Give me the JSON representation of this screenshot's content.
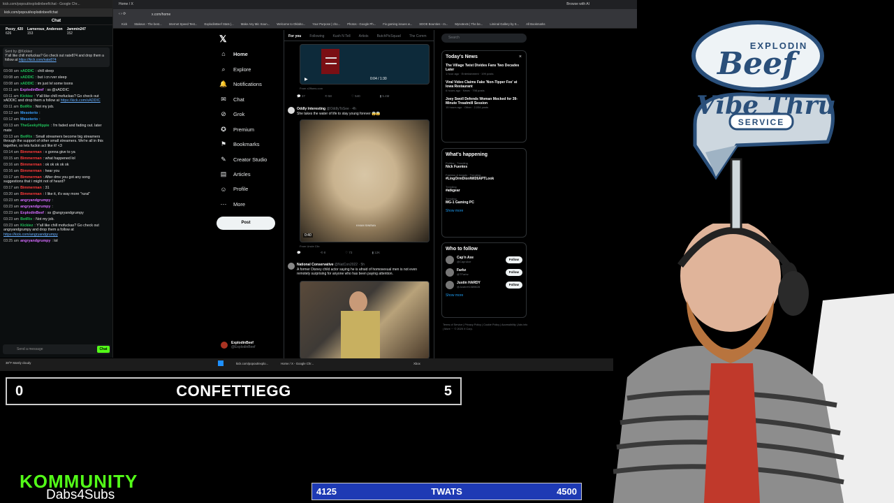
{
  "chat_window": {
    "title_text": "kick.com/popout/explodinbeef/chat - Google Chr...",
    "url": "kick.com/popout/explodinbeef/chat",
    "header": "Chat",
    "gifters": [
      {
        "name": "Pezzy_420",
        "count": "626"
      },
      {
        "name": "Larnerous_Anderson",
        "count": "153"
      },
      {
        "name": "Jammin247",
        "count": "152"
      }
    ],
    "pinned": {
      "sender": "Sent by @Kickiez",
      "text": "Y'all like chill mofuckas? Go check out nate874 and drop them a follow at",
      "link": "https://kick.com/nate874"
    },
    "messages": [
      {
        "time": "03:08 am",
        "user": "xADDIC",
        "color": "#21c05a",
        "text": ": chill sleep"
      },
      {
        "time": "03:08 am",
        "user": "xADDIC",
        "color": "#21c05a",
        "text": ": but i cn rver sleep"
      },
      {
        "time": "03:08 am",
        "user": "xADDIC",
        "color": "#21c05a",
        "text": ": im just lvl some toons"
      },
      {
        "time": "03:11 am",
        "user": "ExplodinBeef",
        "color": "#d46bff",
        "text": ": ss @xADDIC"
      },
      {
        "time": "03:11 am",
        "user": "Kickiez",
        "color": "#21c05a",
        "text": ": Y'all like chill mofuckas? Go check out xADDIC and drop them a follow at ",
        "link": "https://kick.com/xADDIC"
      },
      {
        "time": "03:11 am",
        "user": "BotRix",
        "color": "#21c05a",
        "text": ": Not my job."
      },
      {
        "time": "03:12 am",
        "user": "Mesoterio",
        "color": "#3aa0ff",
        "text": ":"
      },
      {
        "time": "03:12 am",
        "user": "Mesoterio",
        "color": "#3aa0ff",
        "text": ":"
      },
      {
        "time": "03:13 am",
        "user": "TheGeekyHippie",
        "color": "#21c05a",
        "text": ": I'm faded and fading out. later mate"
      },
      {
        "time": "03:13 am",
        "user": "BotRix",
        "color": "#21c05a",
        "text": ": Small streamers become big streamers through the support of other small streamers. We're all in this together, so lets fuckin act like it! <3"
      },
      {
        "time": "03:14 am",
        "user": "Bimmerman",
        "color": "#ff3b3b",
        "text": ": x gonna give to ya"
      },
      {
        "time": "03:15 am",
        "user": "Bimmerman",
        "color": "#ff3b3b",
        "text": ": what happened lol"
      },
      {
        "time": "03:16 am",
        "user": "Bimmerman",
        "color": "#ff3b3b",
        "text": ": ok ok ok ok ok"
      },
      {
        "time": "03:16 am",
        "user": "Bimmerman",
        "color": "#ff3b3b",
        "text": ": hear you"
      },
      {
        "time": "03:17 am",
        "user": "Bimmerman",
        "color": "#ff3b3b",
        "text": ": After dmx you got any song suggestions that i might not of heard?"
      },
      {
        "time": "03:17 am",
        "user": "Bimmerman",
        "color": "#ff3b3b",
        "text": ": 31"
      },
      {
        "time": "03:20 am",
        "user": "Bimmerman",
        "color": "#ff3b3b",
        "text": ": I like it, it's way more \"rural\""
      },
      {
        "time": "03:23 am",
        "user": "angryandgrumpy",
        "color": "#d46bff",
        "text": ":"
      },
      {
        "time": "03:23 am",
        "user": "angryandgrumpy",
        "color": "#d46bff",
        "text": ":"
      },
      {
        "time": "03:23 am",
        "user": "ExplodinBeef",
        "color": "#d46bff",
        "text": ": ss @angryandgrumpy"
      },
      {
        "time": "03:23 am",
        "user": "BotRix",
        "color": "#21c05a",
        "text": ": Not my job."
      },
      {
        "time": "03:23 am",
        "user": "Kickiez",
        "color": "#21c05a",
        "text": ": Y'all like chill mofuckas? Go check out angryandgrumpy and drop them a follow at ",
        "link": "https://kick.com/angryandgrumpy"
      },
      {
        "time": "03:25 am",
        "user": "angryandgrumpy",
        "color": "#d46bff",
        "text": ": lol"
      }
    ],
    "input_placeholder": "Send a message",
    "send_label": "Chat"
  },
  "browser": {
    "tab_title": "Home / X",
    "address": "x.com/home",
    "browse_ai": "Browse with AI",
    "bookmarks": [
      "Kick",
      "Stakeus - The best...",
      "Internet Speed Test...",
      "ExplodinBeef Stats |...",
      "Make Any Mic Soun...",
      "Welcome to Oklaho...",
      "Your Purpose | cho...",
      "Photos - Google Ph...",
      "Fix gaming issues w...",
      "SDOE Bounties - m...",
      "Mynotexts | The be...",
      "Liminal Gallery by S...",
      "All Bookmarks"
    ]
  },
  "x_nav": {
    "items": [
      {
        "label": "Home",
        "icon": "home-icon"
      },
      {
        "label": "Explore",
        "icon": "search-icon"
      },
      {
        "label": "Notifications",
        "icon": "bell-icon"
      },
      {
        "label": "Chat",
        "icon": "chat-icon"
      },
      {
        "label": "Grok",
        "icon": "grok-icon"
      },
      {
        "label": "Premium",
        "icon": "premium-icon"
      },
      {
        "label": "Bookmarks",
        "icon": "bookmark-icon"
      },
      {
        "label": "Creator Studio",
        "icon": "creator-icon"
      },
      {
        "label": "Articles",
        "icon": "articles-icon"
      },
      {
        "label": "Profile",
        "icon": "profile-icon"
      },
      {
        "label": "More",
        "icon": "more-icon"
      }
    ],
    "post_label": "Post",
    "account_name": "ExplodinBeef",
    "account_handle": "@ExplodinBeef"
  },
  "feed": {
    "tabs": [
      "For you",
      "Following",
      "Kush N Tell",
      "Artists",
      "ButchPicSquad",
      "The Comm"
    ],
    "video_time": "0:04 / 1:30",
    "first_source": "From x2ffoms.com",
    "tweets": [
      {
        "name": "Oddly Interesting",
        "handle": "@OddlyToSee · 4h",
        "text": "She takes the water of life to stay young forever 😱😱",
        "duration": "0:40",
        "from": "From Uncle Clix",
        "watermark": "KHAM SINEMA"
      },
      {
        "name": "National Conservative",
        "handle": "@NatCon2022 · 5h",
        "text": "A former Disney child actor saying he is afraid of homosexual men is not even remotely surprising for anyone who has been paying attention."
      }
    ]
  },
  "right_col": {
    "search_placeholder": "Search",
    "todays_news_title": "Today's News",
    "news": [
      {
        "title": "The Village Twist Divides Fans Two Decades Later",
        "meta": "1 hour ago · Entertainment · 199 posts"
      },
      {
        "title": "Viral Video Claims Fake 'Non-Tipper Fee' at Iowa Restaurant",
        "meta": "6 hours ago · News · 798 posts"
      },
      {
        "title": "Joey Swoll Defends Woman Mocked for 39-Minute Treadmill Session",
        "meta": "15 hours ago · Other · 2,034 posts"
      }
    ],
    "happening_title": "What's happening",
    "trends": [
      {
        "context": "Politics · Trending",
        "name": "Nick Fuentes"
      },
      {
        "context": "Fashion & beauty · Trending",
        "name": "#LingOrmDiorAW26APTLook"
      },
      {
        "context": "Trending",
        "name": "#atkgear"
      },
      {
        "context": "Trending",
        "name": "MG-1 Gaming PC"
      }
    ],
    "show_more": "Show more",
    "wtf_title": "Who to follow",
    "follow_suggestions": [
      {
        "name": "Cap'n Axe",
        "handle": "@CapnAxe"
      },
      {
        "name": "Farbz",
        "handle": "@TFarbz"
      },
      {
        "name": "Justin HARDY",
        "handle": "@JustinH1589828"
      }
    ],
    "follow_label": "Follow",
    "footer": "Terms of Service | Privacy Policy | Cookie Policy | Accessibility | Ads info | More ··· © 2025 X Corp."
  },
  "taskbar": {
    "weather": "38°F Mostly cloudy",
    "apps": [
      "kick.com/popout/explo...",
      "Home / X - Google Chr...",
      "Xbox"
    ],
    "time": "3:27 AM",
    "date": "11/5/2025"
  },
  "overlays": {
    "score_left": "0",
    "score_title": "CONFETTIEGG",
    "score_right": "5",
    "goal_current": "4125",
    "goal_title": "TWATS",
    "goal_target": "4500",
    "brand": "KOMMUNITY",
    "brand_sub": "Dabs4Subs",
    "sign_top": "EXPLODIN",
    "sign_beef": "Beef",
    "sign_vibe": "Vibe Thru",
    "sign_service": "SERVICE"
  },
  "colors": {
    "kick_green": "#53fc18",
    "x_blue": "#1d9bf0",
    "goal_blue": "#1e3ab4"
  }
}
